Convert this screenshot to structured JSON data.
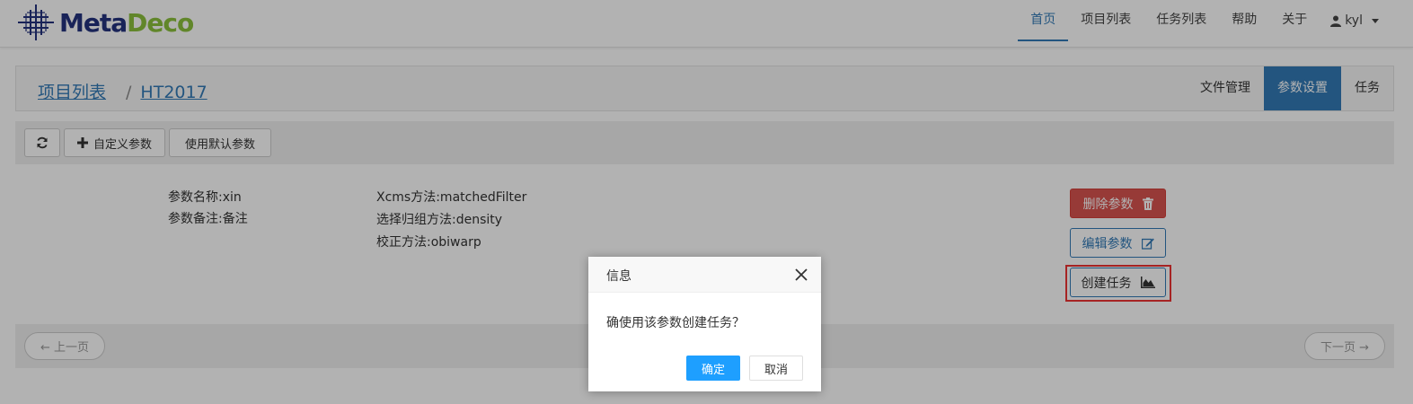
{
  "navbar": {
    "brand": {
      "part1": "Meta",
      "part2": "Deco"
    },
    "items": [
      {
        "label": "首页",
        "active": true
      },
      {
        "label": "项目列表"
      },
      {
        "label": "任务列表"
      },
      {
        "label": "帮助"
      },
      {
        "label": "关于"
      }
    ],
    "user": "kyl"
  },
  "breadcrumb": {
    "root": "项目列表",
    "separator": "/",
    "current": "HT2017"
  },
  "tabs": [
    {
      "label": "文件管理"
    },
    {
      "label": "参数设置",
      "active": true
    },
    {
      "label": "任务"
    }
  ],
  "toolbar": {
    "custom_label": "自定义参数",
    "default_label": "使用默认参数"
  },
  "param": {
    "name": "参数名称:xin",
    "note": "参数备注:备注",
    "xcms": "Xcms方法:matchedFilter",
    "group": "选择归组方法:density",
    "correct": "校正方法:obiwarp"
  },
  "actions": {
    "delete": "删除参数",
    "edit": "编辑参数",
    "create": "创建任务"
  },
  "pager": {
    "prev": "← 上一页",
    "next": "下一页 →"
  },
  "dialog": {
    "title": "信息",
    "message": "确使用该参数创建任务？",
    "ok": "确定",
    "cancel": "取消"
  },
  "colors": {
    "primary": "#337ab7",
    "danger": "#d9534f",
    "dialog_ok": "#1e9fff",
    "highlight": "#ee3333"
  }
}
